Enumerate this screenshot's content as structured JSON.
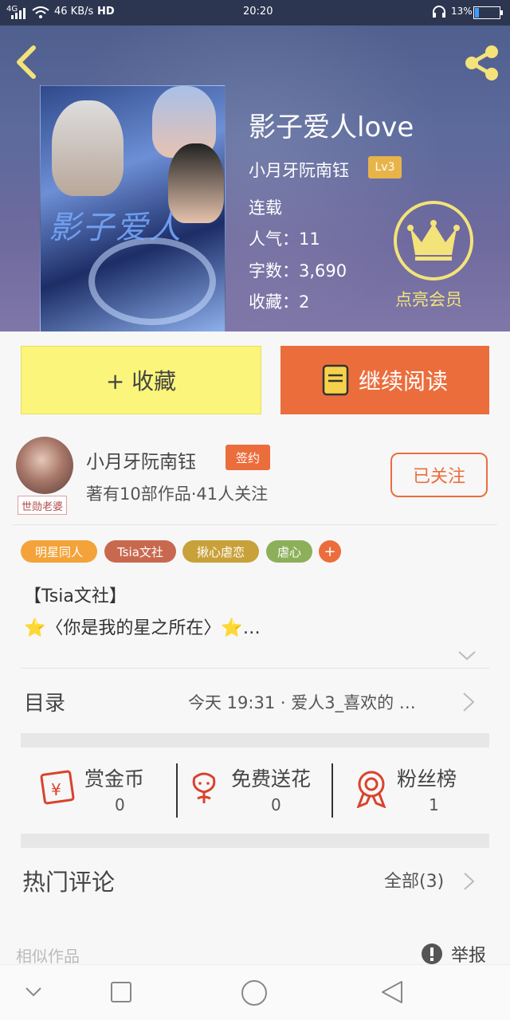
{
  "status_bar": {
    "network": "4G",
    "speed": "46 KB/s",
    "hd": "HD",
    "time": "20:20",
    "battery": "13%"
  },
  "book": {
    "title": "影子爱人love",
    "author": "小月牙阮南钰",
    "level": "Lv3",
    "status": "连载",
    "popularity": "人气：11",
    "word_count": "字数：3,690",
    "favorites": "收藏：2",
    "cover_title_art": "影子爱人"
  },
  "vip": {
    "label": "点亮会员"
  },
  "actions": {
    "favorite_label": "+ 收藏",
    "read_label": "继续阅读"
  },
  "author_card": {
    "name": "小月牙阮南钰",
    "badge": "签约",
    "avatar_caption": "世勋老婆",
    "stats": "著有10部作品·41人关注",
    "follow_label": "已关注"
  },
  "tags": [
    {
      "label": "明星同人",
      "color": "#f3a33a"
    },
    {
      "label": "Tsia文社",
      "color": "#c8694f"
    },
    {
      "label": "揪心虐恋",
      "color": "#c9a13a"
    },
    {
      "label": "虐心",
      "color": "#8cb05a"
    }
  ],
  "intro": {
    "line1": "【Tsia文社】",
    "line2": "⭐〈你是我的星之所在〉⭐…"
  },
  "toc": {
    "label": "目录",
    "latest": "今天 19:31 · 爱人3_喜欢的 …"
  },
  "stats_row": [
    {
      "label": "赏金币",
      "value": "0",
      "icon": "red-envelope-icon"
    },
    {
      "label": "免费送花",
      "value": "0",
      "icon": "flower-icon"
    },
    {
      "label": "粉丝榜",
      "value": "1",
      "icon": "rosette-icon"
    }
  ],
  "comments": {
    "label": "热门评论",
    "all_label": "全部(3)"
  },
  "footer": {
    "similar_label": "相似作品",
    "report_label": "举报"
  },
  "colors": {
    "accent_orange": "#ec6d3c",
    "favorite_yellow": "#fbf57b",
    "vip_gold": "#f3e37a"
  }
}
